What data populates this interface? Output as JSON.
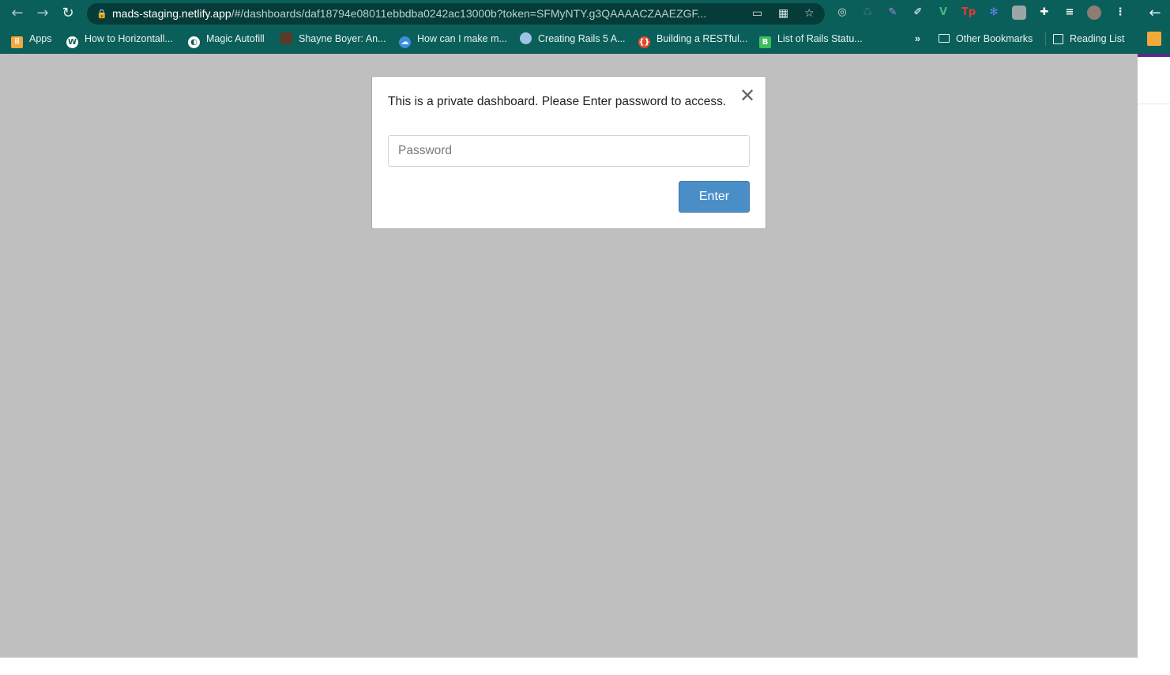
{
  "browser": {
    "url_host": "mads-staging.netlify.app",
    "url_path": "/#/dashboards/daf18794e08011ebbdba0242ac13000b?token=SFMyNTY.g3QAAAACZAAEZGF...",
    "toolbar_color": "#0b5f5a"
  },
  "bookmarks": {
    "items": [
      {
        "label": "Apps",
        "icon": "apps-grid-icon"
      },
      {
        "label": "How to Horizontall...",
        "icon": "wordpress-icon"
      },
      {
        "label": "Magic Autofill",
        "icon": "globe-icon"
      },
      {
        "label": "Shayne Boyer: An...",
        "icon": "avatar-icon"
      },
      {
        "label": "How can I make m...",
        "icon": "cloud-icon"
      },
      {
        "label": "Creating Rails 5 A...",
        "icon": "earth-icon"
      },
      {
        "label": "Building a RESTful...",
        "icon": "braces-icon"
      },
      {
        "label": "List of Rails Statu...",
        "icon": "b-icon"
      }
    ],
    "overflow": "»",
    "other_bookmarks": "Other Bookmarks",
    "reading_list": "Reading List"
  },
  "modal": {
    "message": "This is a private dashboard. Please Enter password to access.",
    "close_glyph": "✕",
    "password_placeholder": "Password",
    "enter_label": "Enter",
    "button_color": "#4a8ec8"
  },
  "page": {
    "overlay_color": "#bfbfbf"
  }
}
